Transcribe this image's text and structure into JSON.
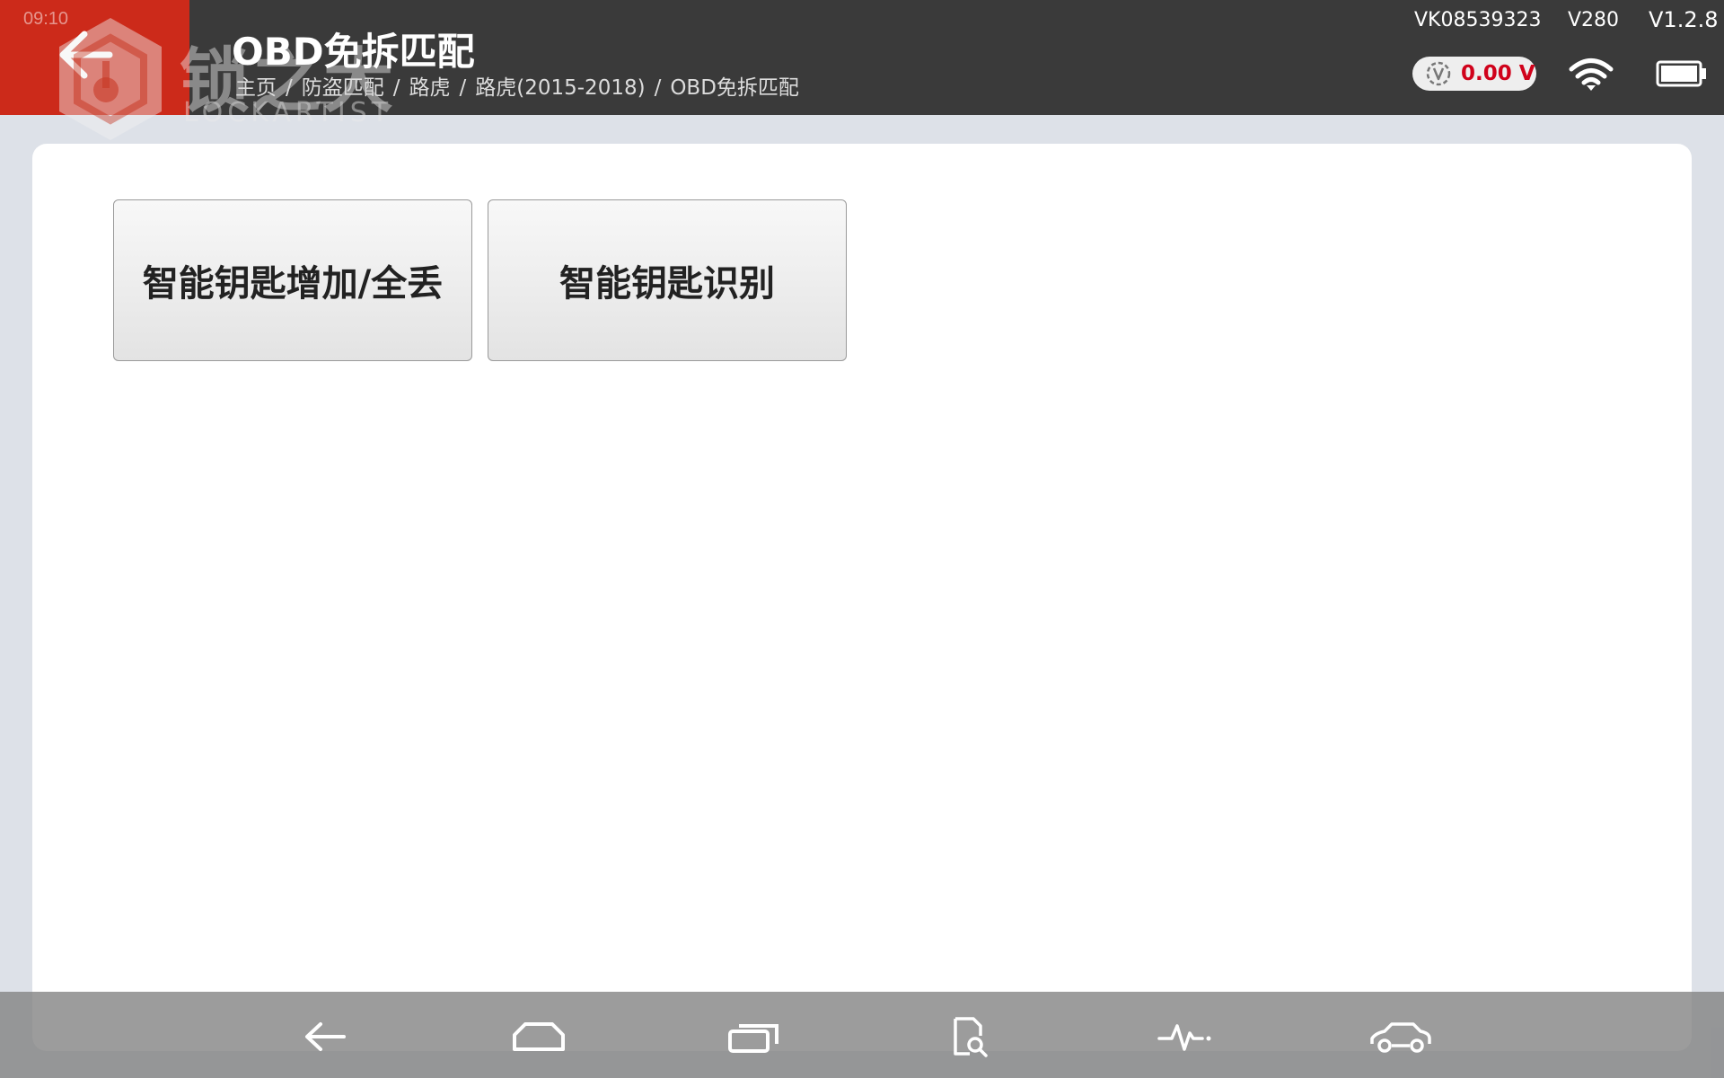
{
  "header": {
    "clock": "09:10",
    "title": "OBD免拆匹配",
    "breadcrumb": [
      "主页",
      "防盗匹配",
      "路虎",
      "路虎(2015-2018)",
      "OBD免拆匹配"
    ],
    "breadcrumb_separator": "/",
    "serial_number": "VK08539323",
    "hardware_version": "V280",
    "software_version": "V1.2.8",
    "voltage": "0.00 V",
    "icons": {
      "back": "back-arrow-icon",
      "voltage": "voltmeter-icon",
      "wifi": "wifi-icon",
      "battery": "battery-icon"
    }
  },
  "watermark": {
    "chinese": "锁之大",
    "english": "LOCKARTIST"
  },
  "main": {
    "buttons": [
      {
        "label": "智能钥匙增加/全丢"
      },
      {
        "label": "智能钥匙识别"
      }
    ]
  },
  "bottom_nav": {
    "items": [
      {
        "icon": "back-arrow-icon"
      },
      {
        "icon": "home-icon"
      },
      {
        "icon": "recent-apps-icon"
      },
      {
        "icon": "document-search-icon"
      },
      {
        "icon": "pulse-icon"
      },
      {
        "icon": "car-icon"
      }
    ]
  },
  "colors": {
    "header_bg": "#3a3a3a",
    "back_area_bg": "#cc2a1a",
    "voltage_text": "#d0021b",
    "page_bg": "#dde1e8",
    "card_bg": "#ffffff"
  }
}
